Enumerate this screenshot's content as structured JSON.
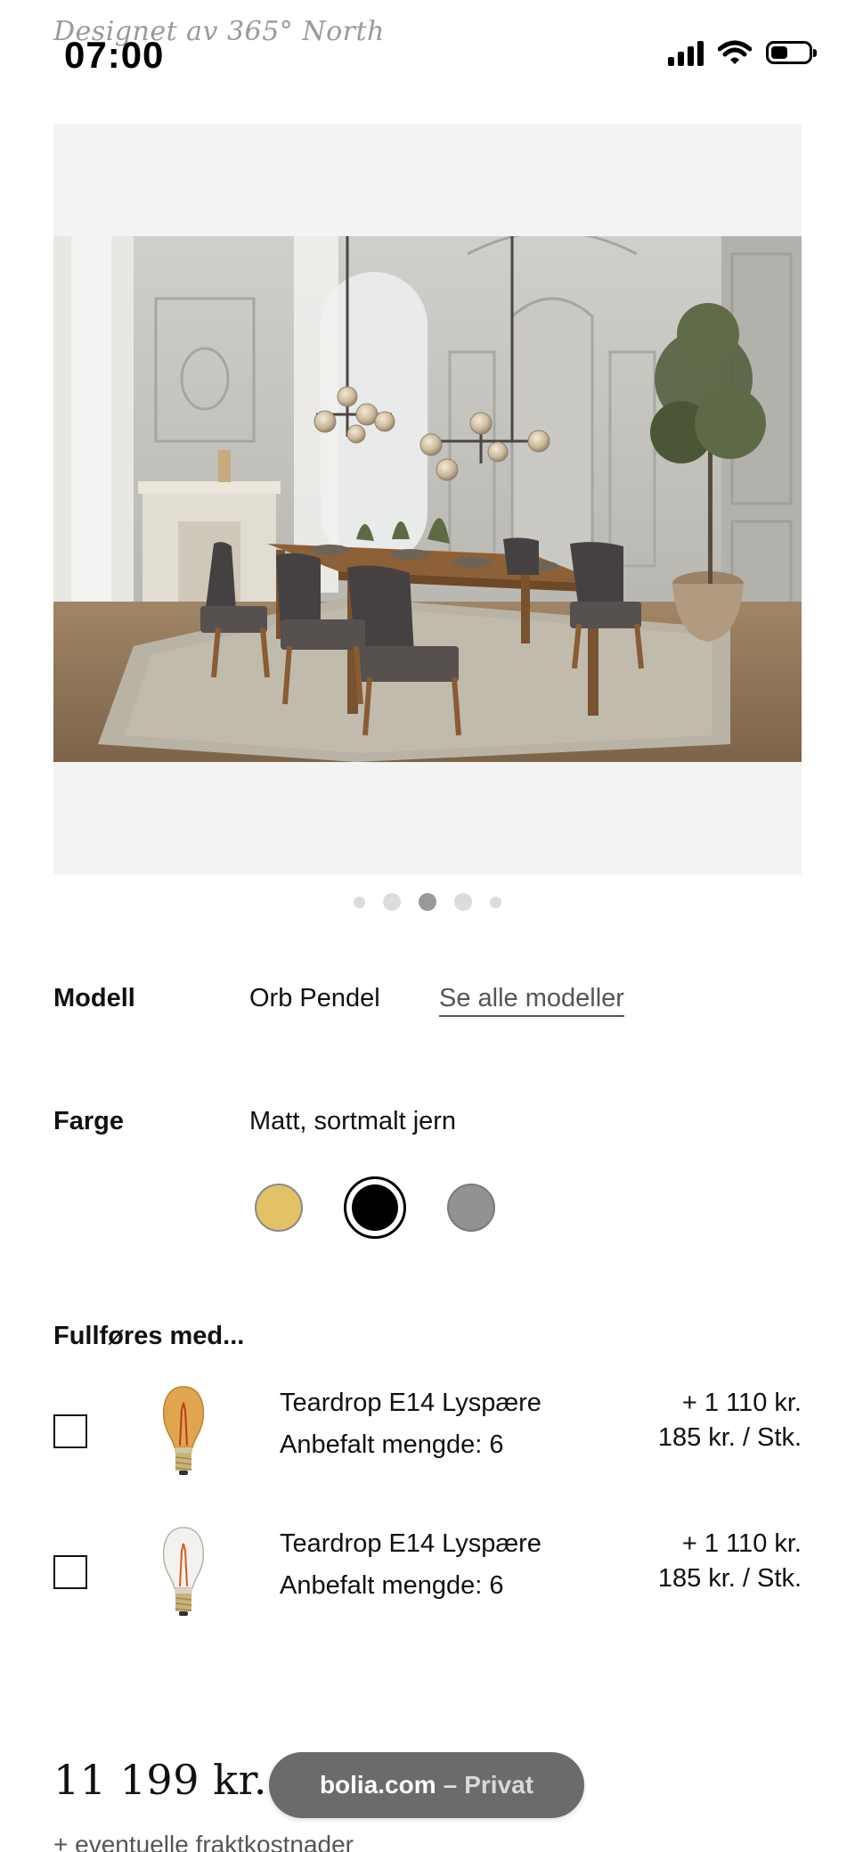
{
  "status_bar": {
    "time": "07:00",
    "overlapping_text": "Designet av 365° North",
    "icons": [
      "signal-icon",
      "wifi-icon",
      "battery-icon"
    ]
  },
  "gallery": {
    "image_alt": "Orb Pendel",
    "dot_count": 5,
    "active_index": 2
  },
  "options": {
    "model": {
      "label": "Modell",
      "value": "Orb Pendel",
      "link": "Se alle modeller"
    },
    "color": {
      "label": "Farge",
      "value": "Matt, sortmalt jern",
      "swatches": [
        {
          "name": "swatch-brass",
          "hex": "#e2c264",
          "selected": false
        },
        {
          "name": "swatch-black",
          "hex": "#000000",
          "selected": true
        },
        {
          "name": "swatch-grey",
          "hex": "#929292",
          "selected": false
        }
      ]
    }
  },
  "complements": {
    "title": "Fullføres med...",
    "items": [
      {
        "name": "Teardrop E14 Lyspære",
        "quantity_text": "Anbefalt mengde: 6",
        "total": "+ 1 110 kr.",
        "unit_price": "185 kr. / Stk.",
        "checked": false,
        "bulb_tint": "amber"
      },
      {
        "name": "Teardrop E14 Lyspære",
        "quantity_text": "Anbefalt mengde: 6",
        "total": "+ 1 110 kr.",
        "unit_price": "185 kr. / Stk.",
        "checked": false,
        "bulb_tint": "clear"
      }
    ]
  },
  "bottom": {
    "price": "11 199 kr.",
    "shipping_note": "+ eventuelle fraktkostnader",
    "url_pill": {
      "domain": "bolia.com",
      "separator": "–",
      "mode": "Privat"
    }
  },
  "colors": {
    "gallery_bg": "#f3f3f3",
    "dot_active": "#999999",
    "dot_inactive": "#dcdcdc",
    "pill_bg": "#6b6b6b"
  }
}
